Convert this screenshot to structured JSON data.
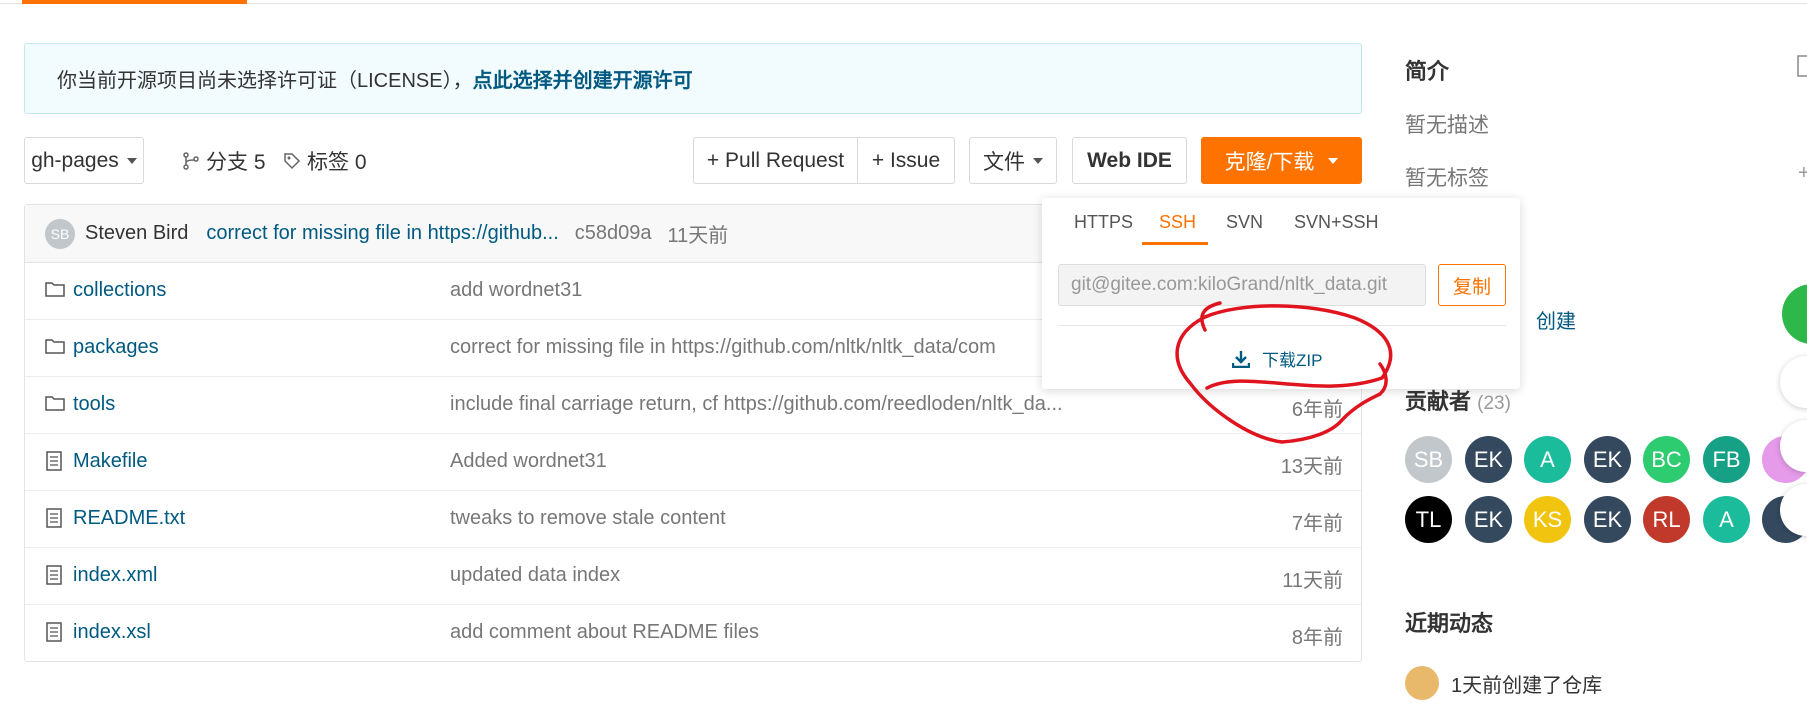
{
  "colors": {
    "accent": "#fe7300",
    "link": "#005980",
    "muted": "#777777"
  },
  "license": {
    "message": "你当前开源项目尚未选择许可证（LICENSE），",
    "link": "点此选择并创建开源许可"
  },
  "toolbar": {
    "branch": "gh-pages",
    "branches": "分支 5",
    "tags": "标签 0",
    "pull_request": "+ Pull Request",
    "issue": "+ Issue",
    "file": "文件",
    "web_ide": "Web IDE",
    "clone": "克隆/下载"
  },
  "commit": {
    "avatar": "SB",
    "author": "Steven Bird",
    "message": "correct for missing file in https://github...",
    "hash": "c58d09a",
    "time": "11天前"
  },
  "files": [
    {
      "name": "collections",
      "type": "folder",
      "message": "add wordnet31",
      "time": ""
    },
    {
      "name": "packages",
      "type": "folder",
      "message": "correct for missing file in https://github.com/nltk/nltk_data/com",
      "time": ""
    },
    {
      "name": "tools",
      "type": "folder",
      "message": "include final carriage return, cf https://github.com/reedloden/nltk_da...",
      "time": "6年前"
    },
    {
      "name": "Makefile",
      "type": "file",
      "message": "Added wordnet31",
      "time": "13天前"
    },
    {
      "name": "README.txt",
      "type": "file",
      "message": "tweaks to remove stale content",
      "time": "7年前"
    },
    {
      "name": "index.xml",
      "type": "file",
      "message": "updated data index",
      "time": "11天前"
    },
    {
      "name": "index.xsl",
      "type": "file",
      "message": "add comment about README files",
      "time": "8年前"
    }
  ],
  "clone_dropdown": {
    "tabs": [
      "HTTPS",
      "SSH",
      "SVN",
      "SVN+SSH"
    ],
    "active_tab": "SSH",
    "url": "git@gitee.com:kiloGrand/nltk_data.git",
    "copy": "复制",
    "download_zip": "下载ZIP"
  },
  "sidebar": {
    "intro_title": "简介",
    "no_description": "暂无描述",
    "no_tags": "暂无标签",
    "create_link": "创建",
    "contributors_title": "贡献者",
    "contributors_count": "(23)",
    "contributors": [
      {
        "initials": "SB",
        "color": "#c2c7cc"
      },
      {
        "initials": "EK",
        "color": "#34495e"
      },
      {
        "initials": "A",
        "color": "#1abc9c"
      },
      {
        "initials": "EK",
        "color": "#34495e"
      },
      {
        "initials": "BC",
        "color": "#2ecc71"
      },
      {
        "initials": "FB",
        "color": "#16a085"
      },
      {
        "initials": "",
        "color": "#e59aea"
      },
      {
        "initials": "TL",
        "color": "#000000"
      },
      {
        "initials": "EK",
        "color": "#34495e"
      },
      {
        "initials": "KS",
        "color": "#f1c40f"
      },
      {
        "initials": "EK",
        "color": "#34495e"
      },
      {
        "initials": "RL",
        "color": "#c0392b"
      },
      {
        "initials": "A",
        "color": "#1abc9c"
      },
      {
        "initials": "",
        "color": "#34495e"
      }
    ],
    "recent_title": "近期动态",
    "activity": "1天前创建了仓库"
  }
}
